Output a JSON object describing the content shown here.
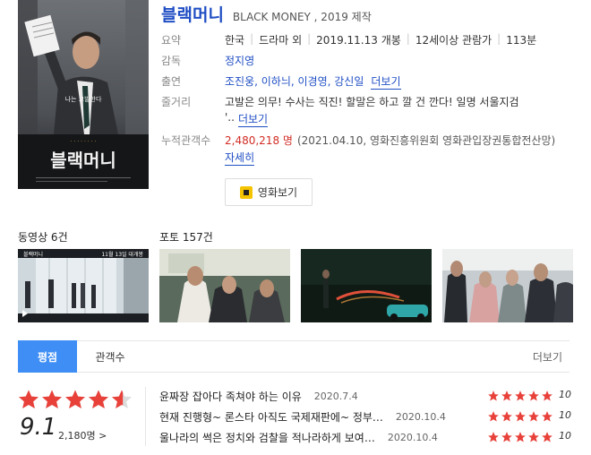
{
  "movie": {
    "title": "블랙머니",
    "subtitle": "BLACK MONEY , 2019 제작",
    "poster_text": "블랙머니",
    "poster_tagline": "나는 고발한다"
  },
  "info": {
    "summary_label": "요약",
    "country": "한국",
    "genre": "드라마 외",
    "release": "2019.11.13 개봉",
    "rating": "12세이상 관람가",
    "runtime": "113분",
    "director_label": "감독",
    "director": "정지영",
    "cast_label": "출연",
    "cast": "조진웅, 이하늬, 이경영, 강신일",
    "cast_more": "더보기",
    "plot_label": "줄거리",
    "plot_line1": "고발은 의무! 수사는 직진! 할말은 하고 깔 건 깐다! 일명 서울지검",
    "plot_line2": "'..",
    "plot_more": "더보기",
    "audience_label": "누적관객수",
    "audience_count": "2,480,218 명",
    "audience_source": "(2021.04.10, 영화진흥위원회 영화관입장권통합전산망)",
    "audience_detail": "자세히"
  },
  "watch_button": "영화보기",
  "videos_label": "동영상 6건",
  "photos_label": "포토 157건",
  "video_thumb_caption": "블랙머니",
  "video_thumb_date": "11월 13일 대개봉",
  "tabs": {
    "active": "평점",
    "second": "관객수",
    "more": "더보기"
  },
  "rating": {
    "stars": 4.55,
    "score": "9.1",
    "votes": "2,180명 >"
  },
  "reviews": [
    {
      "text": "윤짜장 잡아다 족쳐야 하는 이유",
      "date": "2020.7.4",
      "score": "10"
    },
    {
      "text": "현재 진행형~ 론스타 아직도 국제재판에~ 정부…",
      "date": "2020.10.4",
      "score": "10"
    },
    {
      "text": "울나라의 썩은 정치와 검찰을 적나라하게 보여…",
      "date": "2020.10.4",
      "score": "10"
    }
  ],
  "colors": {
    "title_blue": "#1f4ec4",
    "accent_red": "#d22d26",
    "star_red": "#e8413a",
    "tab_blue": "#3e8ef5"
  }
}
